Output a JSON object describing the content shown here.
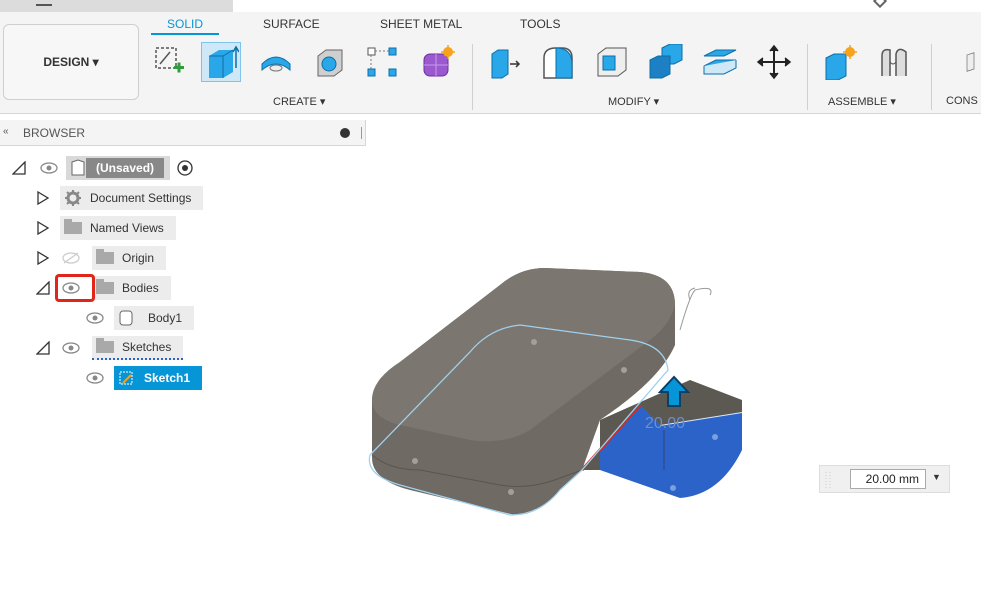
{
  "toolbar": {
    "design_label": "DESIGN ▾",
    "tabs": [
      {
        "label": "SOLID",
        "active": true
      },
      {
        "label": "SURFACE",
        "active": false
      },
      {
        "label": "SHEET METAL",
        "active": false
      },
      {
        "label": "TOOLS",
        "active": false
      }
    ],
    "groups": {
      "create": "CREATE ▾",
      "modify": "MODIFY ▾",
      "assemble": "ASSEMBLE ▾",
      "construct": "CONS"
    },
    "tools": {
      "create": [
        "new-sketch-icon",
        "extrude-icon",
        "revolve-icon",
        "hole-icon",
        "rectangular-pattern-icon",
        "create-form-icon"
      ],
      "modify": [
        "press-pull-icon",
        "fillet-icon",
        "shell-icon",
        "combine-icon",
        "offset-face-icon",
        "move-icon"
      ],
      "assemble": [
        "new-component-icon",
        "joint-icon"
      ],
      "construct": [
        "offset-plane-icon"
      ]
    }
  },
  "browser": {
    "title": "BROWSER",
    "collapse_icon": "«",
    "root": {
      "label": "(Unsaved)"
    },
    "items": [
      {
        "label": "Document Settings",
        "icon": "gear-icon"
      },
      {
        "label": "Named Views",
        "icon": "folder-icon"
      },
      {
        "label": "Origin",
        "icon": "folder-icon",
        "hidden": true
      },
      {
        "label": "Bodies",
        "icon": "folder-icon"
      },
      {
        "label": "Body1",
        "icon": "body-icon"
      },
      {
        "label": "Sketches",
        "icon": "folder-icon"
      },
      {
        "label": "Sketch1",
        "icon": "sketch-icon",
        "selected": true
      }
    ]
  },
  "viewport": {
    "dimension_text": "20.00",
    "dimension_input": "20.00 mm"
  },
  "colors": {
    "accent": "#0696d7",
    "body_gray": "#6f6a63",
    "extrude_blue": "#2b63c9",
    "highlight_red": "#e1251b"
  }
}
